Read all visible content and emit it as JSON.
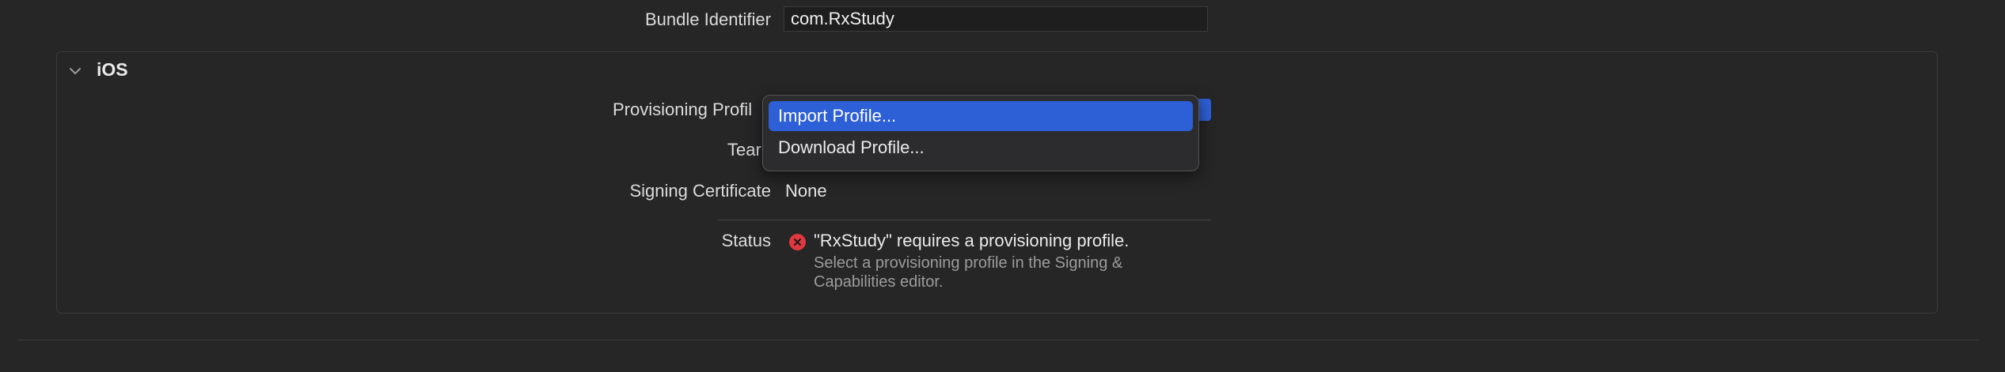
{
  "general": {
    "bundle_identifier_label": "Bundle Identifier",
    "bundle_identifier_value": "com.RxStudy"
  },
  "ios": {
    "section_title": "iOS",
    "provisioning_profile_label": "Provisioning Profil",
    "team_label": "Tear",
    "signing_certificate_label": "Signing Certificate",
    "signing_certificate_value": "None",
    "status_label": "Status",
    "status_title": "\"RxStudy\" requires a provisioning profile.",
    "status_detail": "Select a provisioning profile in the Signing & Capabilities editor."
  },
  "menu": {
    "items": [
      {
        "label": "Import Profile...",
        "selected": true
      },
      {
        "label": "Download Profile...",
        "selected": false
      }
    ]
  },
  "colors": {
    "background": "#262626",
    "accent": "#2d5fd6",
    "error": "#e0383e"
  },
  "icons": {
    "chevron": "chevron-down-icon",
    "status": "error-x-icon"
  }
}
